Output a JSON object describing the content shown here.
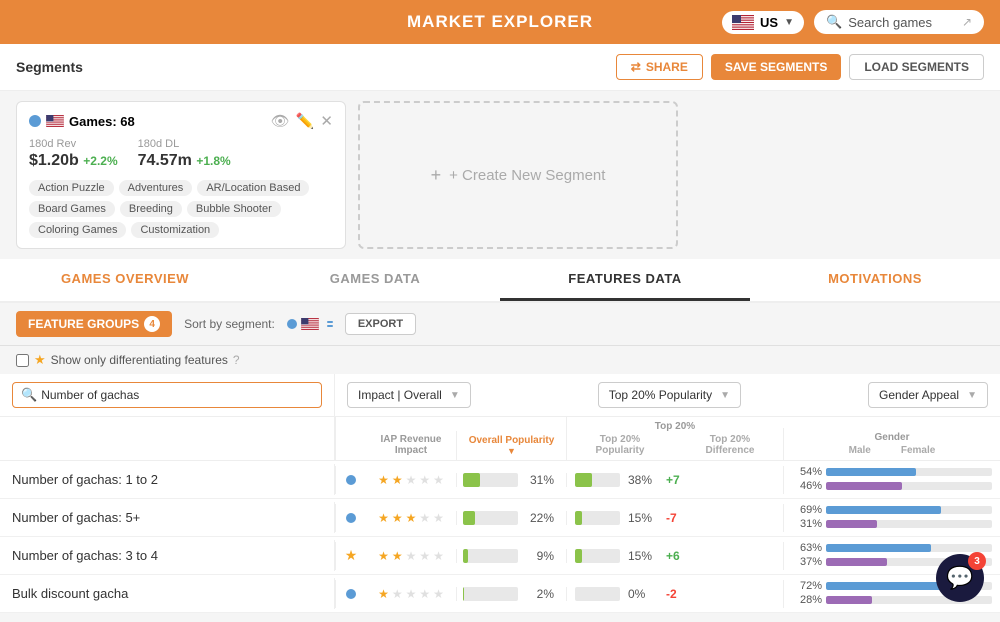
{
  "header": {
    "title": "MARKET EXPLORER",
    "country": "US",
    "search_placeholder": "Search games"
  },
  "segments_bar": {
    "title": "Segments",
    "share_label": "SHARE",
    "save_label": "SAVE SEGMENTS",
    "load_label": "LOAD SEGMENTS"
  },
  "segment_card": {
    "title": "Games: 68",
    "rev_label": "180d Rev",
    "rev_value": "$1.20b",
    "rev_change": "+2.2%",
    "dl_label": "180d DL",
    "dl_value": "74.57m",
    "dl_change": "+1.8%",
    "tags": [
      "Action Puzzle",
      "Adventures",
      "AR/Location Based",
      "Board Games",
      "Breeding",
      "Bubble Shooter",
      "Coloring Games",
      "Customization"
    ]
  },
  "create_segment": {
    "label": "+ Create New Segment"
  },
  "tabs": [
    {
      "label": "GAMES OVERVIEW",
      "active": false,
      "orange": true
    },
    {
      "label": "GAMES DATA",
      "active": false,
      "orange": false
    },
    {
      "label": "FEATURES DATA",
      "active": true,
      "orange": false
    },
    {
      "label": "MOTIVATIONS",
      "active": false,
      "orange": true
    }
  ],
  "toolbar": {
    "feature_groups_label": "FEATURE GROUPS",
    "feature_groups_count": "4",
    "sort_label": "Sort by segment:",
    "export_label": "EXPORT"
  },
  "filter": {
    "show_diff_label": "Show only differentiating features",
    "question": "?"
  },
  "search_input": {
    "placeholder": "Number of gachas",
    "value": "Number of gachas"
  },
  "dropdowns": {
    "impact": "Impact | Overall",
    "top20": "Top 20% Popularity",
    "gender": "Gender Appeal"
  },
  "table_headers": {
    "iap": "IAP Revenue Impact",
    "popularity": "Overall Popularity",
    "top20_pop": "Top 20% Popularity",
    "top20_diff": "Top 20% Difference",
    "male": "Male",
    "female": "Female"
  },
  "rows": [
    {
      "name": "Number of gachas: 1 to 2",
      "dot": "blue",
      "iap_stars": 2,
      "pop_pct": "31%",
      "pop_bar": 31,
      "top20_pct": "38%",
      "top20_bar": 38,
      "top20_diff": "+7",
      "male_pct": "54%",
      "male_bar": 54,
      "female_pct": "46%",
      "female_bar": 46
    },
    {
      "name": "Number of gachas: 5+",
      "dot": "blue",
      "iap_stars": 3,
      "pop_pct": "22%",
      "pop_bar": 22,
      "top20_pct": "15%",
      "top20_bar": 15,
      "top20_diff": "-7",
      "male_pct": "69%",
      "male_bar": 69,
      "female_pct": "31%",
      "female_bar": 31
    },
    {
      "name": "Number of gachas: 3 to 4",
      "dot": "star",
      "iap_stars": 2,
      "pop_pct": "9%",
      "pop_bar": 9,
      "top20_pct": "15%",
      "top20_bar": 15,
      "top20_diff": "+6",
      "male_pct": "63%",
      "male_bar": 63,
      "female_pct": "37%",
      "female_bar": 37
    },
    {
      "name": "Bulk discount gacha",
      "dot": "blue",
      "iap_stars": 1,
      "pop_pct": "2%",
      "pop_bar": 2,
      "top20_pct": "0%",
      "top20_bar": 0,
      "top20_diff": "-2",
      "male_pct": "72%",
      "male_bar": 72,
      "female_pct": "28%",
      "female_bar": 28
    }
  ],
  "chat": {
    "badge": "3"
  }
}
